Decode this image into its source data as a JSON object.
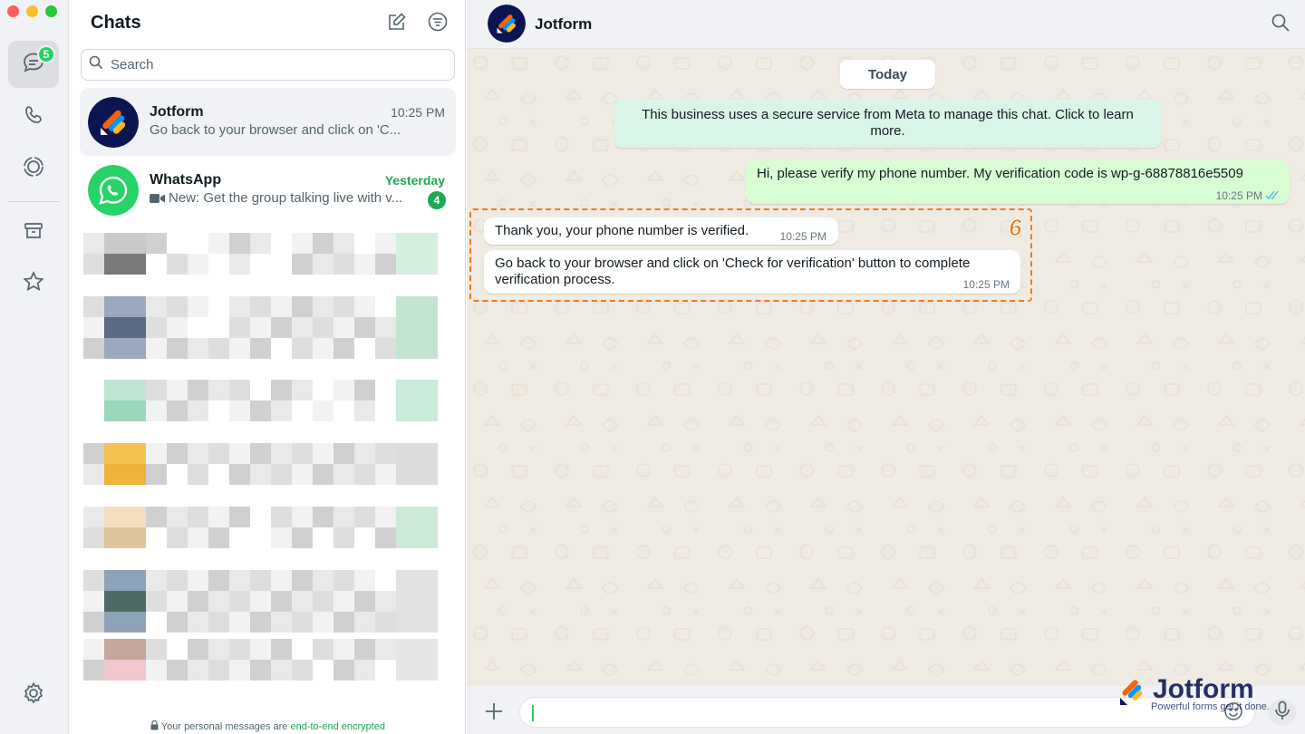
{
  "rail": {
    "chats_badge": "5"
  },
  "list": {
    "title": "Chats",
    "search_placeholder": "Search",
    "chats": [
      {
        "name": "Jotform",
        "time": "10:25 PM",
        "preview": "Go back to your browser and click on 'C..."
      },
      {
        "name": "WhatsApp",
        "time": "Yesterday",
        "preview": "New: Get the group talking live with v...",
        "unread": "4"
      }
    ],
    "encryption_text": "Your personal messages are ",
    "encryption_link": "end-to-end encrypted"
  },
  "conversation": {
    "title": "Jotform",
    "date_chip": "Today",
    "system_message": "This business uses a secure service from Meta to manage this chat. Click to learn more.",
    "messages": [
      {
        "direction": "out",
        "text": "Hi, please verify my phone number. My verification code is wp-g-68878816e5509",
        "time": "10:25 PM"
      },
      {
        "direction": "in",
        "text": "Thank you, your phone number is verified.",
        "time": "10:25 PM"
      },
      {
        "direction": "in",
        "text": "Go back to your browser and click on 'Check for verification' button to complete verification process.",
        "time": "10:25 PM"
      }
    ],
    "step_number": "6"
  },
  "watermark": {
    "brand": "Jotform",
    "tagline": "Powerful forms get it done."
  },
  "colors": {
    "accent_green": "#25d366",
    "highlight_orange": "#f07a1e",
    "outgoing_bubble": "#d9fdd3",
    "system_bubble": "#d9f5e7"
  },
  "icons": [
    "chats-icon",
    "calls-icon",
    "status-icon",
    "archive-icon",
    "starred-icon",
    "settings-icon",
    "new-chat-icon",
    "filter-icon",
    "search-icon",
    "lock-icon",
    "video-icon",
    "double-check-icon",
    "plus-icon",
    "emoji-icon",
    "mic-icon"
  ]
}
